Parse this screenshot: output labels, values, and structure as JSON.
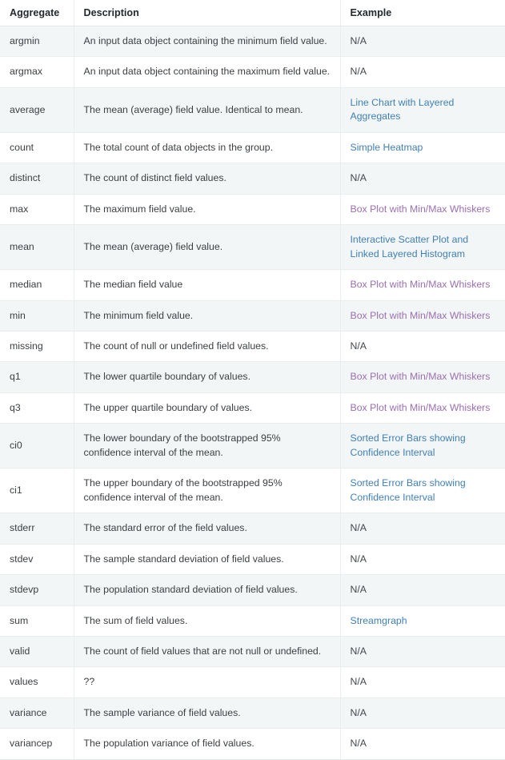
{
  "table": {
    "columns": [
      {
        "key": "aggregate",
        "label": "Aggregate"
      },
      {
        "key": "description",
        "label": "Description"
      },
      {
        "key": "example",
        "label": "Example"
      }
    ],
    "link_colors": {
      "unvisited": "#4180b5",
      "visited": "#9b6fb0"
    },
    "row_colors": {
      "odd": "#f2f6f6",
      "even": "#ffffff",
      "border": "#e9eded"
    },
    "na_label": "N/A",
    "rows": [
      {
        "aggregate": "argmin",
        "description": "An input data object containing the minimum field value.",
        "example": "N/A",
        "example_type": "text"
      },
      {
        "aggregate": "argmax",
        "description": "An input data object containing the maximum field value.",
        "example": "N/A",
        "example_type": "text"
      },
      {
        "aggregate": "average",
        "description": "The mean (average) field value. Identical to mean.",
        "example": "Line Chart with Layered Aggregates",
        "example_type": "link",
        "example_link_state": "unvisited"
      },
      {
        "aggregate": "count",
        "description": "The total count of data objects in the group.",
        "example": "Simple Heatmap",
        "example_type": "link",
        "example_link_state": "unvisited"
      },
      {
        "aggregate": "distinct",
        "description": "The count of distinct field values.",
        "example": "N/A",
        "example_type": "text"
      },
      {
        "aggregate": "max",
        "description": "The maximum field value.",
        "example": "Box Plot with Min/Max Whiskers",
        "example_type": "link",
        "example_link_state": "visited"
      },
      {
        "aggregate": "mean",
        "description": "The mean (average) field value.",
        "example": "Interactive Scatter Plot and Linked Layered Histogram",
        "example_type": "link",
        "example_link_state": "unvisited"
      },
      {
        "aggregate": "median",
        "description": "The median field value",
        "example": "Box Plot with Min/Max Whiskers",
        "example_type": "link",
        "example_link_state": "visited"
      },
      {
        "aggregate": "min",
        "description": "The minimum field value.",
        "example": "Box Plot with Min/Max Whiskers",
        "example_type": "link",
        "example_link_state": "visited"
      },
      {
        "aggregate": "missing",
        "description": "The count of null or undefined field values.",
        "example": "N/A",
        "example_type": "text"
      },
      {
        "aggregate": "q1",
        "description": "The lower quartile boundary of values.",
        "example": "Box Plot with Min/Max Whiskers",
        "example_type": "link",
        "example_link_state": "visited"
      },
      {
        "aggregate": "q3",
        "description": "The upper quartile boundary of values.",
        "example": "Box Plot with Min/Max Whiskers",
        "example_type": "link",
        "example_link_state": "visited"
      },
      {
        "aggregate": "ci0",
        "description": "The lower boundary of the bootstrapped 95% confidence interval of the mean.",
        "example": "Sorted Error Bars showing Confidence Interval",
        "example_type": "link",
        "example_link_state": "unvisited"
      },
      {
        "aggregate": "ci1",
        "description": "The upper boundary of the bootstrapped 95% confidence interval of the mean.",
        "example": "Sorted Error Bars showing Confidence Interval",
        "example_type": "link",
        "example_link_state": "unvisited"
      },
      {
        "aggregate": "stderr",
        "description": "The standard error of the field values.",
        "example": "N/A",
        "example_type": "text"
      },
      {
        "aggregate": "stdev",
        "description": "The sample standard deviation of field values.",
        "example": "N/A",
        "example_type": "text"
      },
      {
        "aggregate": "stdevp",
        "description": "The population standard deviation of field values.",
        "example": "N/A",
        "example_type": "text"
      },
      {
        "aggregate": "sum",
        "description": "The sum of field values.",
        "example": "Streamgraph",
        "example_type": "link",
        "example_link_state": "unvisited"
      },
      {
        "aggregate": "valid",
        "description": "The count of field values that are not null or undefined.",
        "example": "N/A",
        "example_type": "text"
      },
      {
        "aggregate": "values",
        "description": "??",
        "example": "N/A",
        "example_type": "text"
      },
      {
        "aggregate": "variance",
        "description": "The sample variance of field values.",
        "example": "N/A",
        "example_type": "text"
      },
      {
        "aggregate": "variancep",
        "description": "The population variance of field values.",
        "example": "N/A",
        "example_type": "text"
      }
    ]
  }
}
